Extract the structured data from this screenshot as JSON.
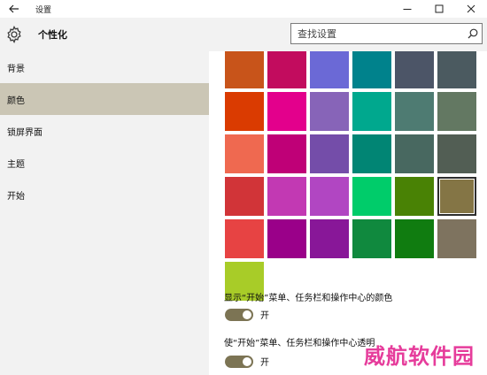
{
  "window": {
    "title": "设置",
    "controls": {
      "minimize": "minimize-icon",
      "maximize": "maximize-icon",
      "close": "close-icon"
    }
  },
  "header": {
    "page_title": "个性化",
    "search": {
      "placeholder": "查找设置",
      "value": ""
    }
  },
  "sidebar": {
    "items": [
      {
        "label": "背景",
        "active": false
      },
      {
        "label": "颜色",
        "active": true
      },
      {
        "label": "锁屏界面",
        "active": false
      },
      {
        "label": "主题",
        "active": false
      },
      {
        "label": "开始",
        "active": false
      }
    ]
  },
  "colors": {
    "accent_selection": "#cbc6b5",
    "toggle_on": "#7c7454",
    "watermark": "#e63c9b"
  },
  "palette": {
    "selected_index": 23,
    "swatches": [
      "#c8541a",
      "#c20c5e",
      "#6b69d6",
      "#00828c",
      "#4c5567",
      "#4b5a60",
      "#da3b01",
      "#e3008c",
      "#8764b8",
      "#00a88e",
      "#4e7b72",
      "#637862",
      "#ef6950",
      "#bf0077",
      "#744da9",
      "#018574",
      "#486860",
      "#525e54",
      "#d13438",
      "#c239b3",
      "#b146c2",
      "#00cc6a",
      "#498205",
      "#847545",
      "#e74343",
      "#9a0089",
      "#881798",
      "#10893e",
      "#107c10",
      "#7e735f",
      "#a8cc28"
    ]
  },
  "settings": [
    {
      "label": "显示“开始”菜单、任务栏和操作中心的颜色",
      "toggle_on": true,
      "state_text": "开"
    },
    {
      "label": "使“开始”菜单、任务栏和操作中心透明",
      "toggle_on": true,
      "state_text": "开"
    }
  ],
  "watermark_text": "威航软件园"
}
